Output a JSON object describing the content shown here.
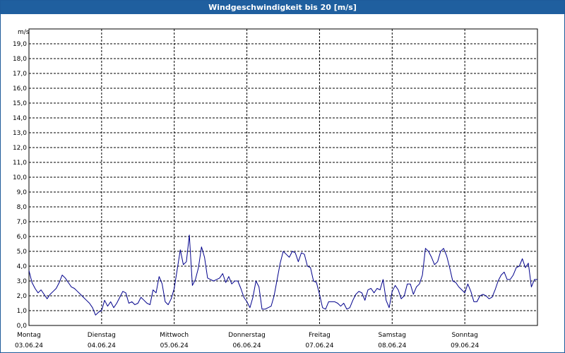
{
  "window": {
    "title": "Windgeschwindigkeit bis 20 [m/s]"
  },
  "colors": {
    "titlebar": "#1f5f9f",
    "series": "#00008b",
    "grid": "#000000"
  },
  "chart_data": {
    "type": "line",
    "title": "Windgeschwindigkeit bis 20 [m/s]",
    "ylabel": "m/s",
    "ylim": [
      0,
      20
    ],
    "xlim": [
      0,
      7
    ],
    "grid": true,
    "yticks": [
      "0,0",
      "1,0",
      "2,0",
      "3,0",
      "4,0",
      "5,0",
      "6,0",
      "7,0",
      "8,0",
      "9,0",
      "10,0",
      "11,0",
      "12,0",
      "13,0",
      "14,0",
      "15,0",
      "16,0",
      "17,0",
      "18,0",
      "19,0"
    ],
    "days": [
      {
        "name": "Montag",
        "date": "03.06.24"
      },
      {
        "name": "Dienstag",
        "date": "04.06.24"
      },
      {
        "name": "Mittwoch",
        "date": "05.06.24"
      },
      {
        "name": "Donnerstag",
        "date": "06.06.24"
      },
      {
        "name": "Freitag",
        "date": "07.06.24"
      },
      {
        "name": "Samstag",
        "date": "08.06.24"
      },
      {
        "name": "Sonntag",
        "date": "09.06.24"
      }
    ],
    "series": [
      {
        "values": [
          3.7,
          2.9,
          2.5,
          2.2,
          2.4,
          2.1,
          1.8,
          2.1,
          2.3,
          2.5,
          2.9,
          3.4,
          3.2,
          2.9,
          2.6,
          2.5,
          2.3,
          2.1,
          1.9,
          1.7,
          1.5,
          1.2,
          0.7,
          0.9,
          1.0,
          1.7,
          1.3,
          1.6,
          1.2,
          1.5,
          1.9,
          2.3,
          2.2,
          1.5,
          1.6,
          1.4,
          1.5,
          1.9,
          1.7,
          1.5,
          1.4,
          2.4,
          2.2,
          3.3,
          2.8,
          1.6,
          1.4,
          1.8,
          2.5,
          3.8,
          5.1,
          4.1,
          4.3,
          6.1,
          2.7,
          3.1,
          3.9,
          5.3,
          4.6,
          3.2,
          3.1,
          3.0,
          3.1,
          3.2,
          3.5,
          2.9,
          3.3,
          2.8,
          3.0,
          3.0,
          2.5,
          1.9,
          1.6,
          1.2,
          1.9,
          3.0,
          2.6,
          1.1,
          1.1,
          1.2,
          1.3,
          2.0,
          3.1,
          4.2,
          5.0,
          4.8,
          4.6,
          5.0,
          4.9,
          4.3,
          4.9,
          4.8,
          4.0,
          3.9,
          3.0,
          2.9,
          2.1,
          1.2,
          1.1,
          1.6,
          1.6,
          1.6,
          1.5,
          1.3,
          1.5,
          1.1,
          1.2,
          1.7,
          2.1,
          2.3,
          2.2,
          1.7,
          2.4,
          2.5,
          2.2,
          2.5,
          2.4,
          3.1,
          1.7,
          1.2,
          2.3,
          2.7,
          2.4,
          1.8,
          2.0,
          2.8,
          2.8,
          2.1,
          2.6,
          2.8,
          3.4,
          5.2,
          5.0,
          4.6,
          4.1,
          4.3,
          5.0,
          5.2,
          4.7,
          3.9,
          3.0,
          2.9,
          2.6,
          2.4,
          2.2,
          2.8,
          2.3,
          1.6,
          1.6,
          2.0,
          2.1,
          2.0,
          1.8,
          1.9,
          2.4,
          3.0,
          3.4,
          3.6,
          3.1,
          3.1,
          3.4,
          3.9,
          4.0,
          4.5,
          3.9,
          4.2,
          2.6,
          3.1,
          3.1
        ]
      }
    ]
  }
}
